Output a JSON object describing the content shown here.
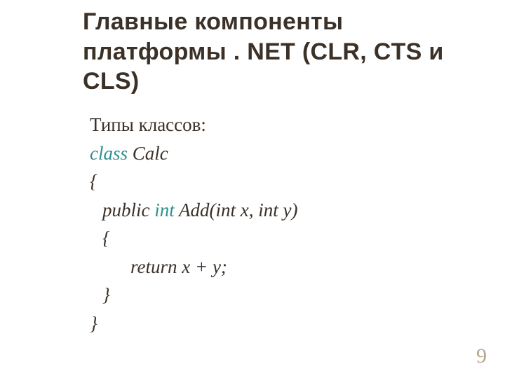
{
  "heading": "Главные компоненты платформы . NET (CLR, CTS и CLS)",
  "body": {
    "subtitle": "Типы классов:",
    "code": {
      "l1_kw": "class",
      "l1_rest": " Calc",
      "l2": "{",
      "l3_pre": "public ",
      "l3_kw": "int",
      "l3_rest": " Add(int x, int y)",
      "l4": "{",
      "l5": "return x + y;",
      "l6": "}",
      "l7": "}"
    }
  },
  "page_number": "9"
}
